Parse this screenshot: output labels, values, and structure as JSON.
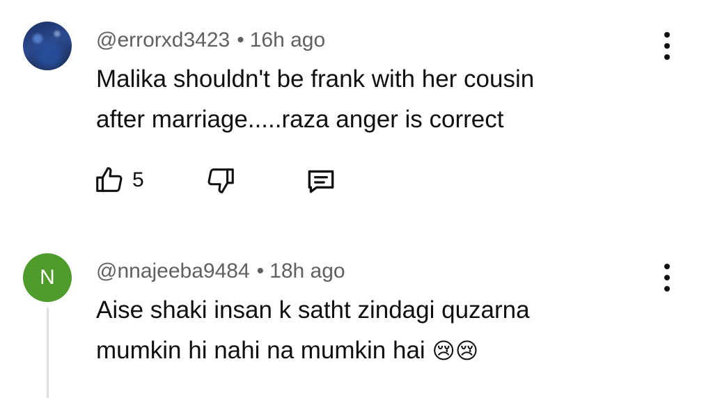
{
  "comments": [
    {
      "handle": "@errorxd3423",
      "separator": "•",
      "time": "16h ago",
      "text_line1": "Malika shouldn't be frank with her cousin",
      "text_line2": "after marriage.....raza anger is correct",
      "likes": "5",
      "avatar_type": "photo"
    },
    {
      "handle": "@nnajeeba9484",
      "separator": "•",
      "time": "18h ago",
      "text_line1": "Aise shaki insan k satht zindagi quzarna",
      "text_line2": "mumkin hi nahi na mumkin hai",
      "emoji": "😢😢",
      "avatar_letter": "N",
      "avatar_color": "#4f9b2c"
    }
  ],
  "icons": {
    "like": "thumbs-up-icon",
    "dislike": "thumbs-down-icon",
    "reply": "reply-comment-icon",
    "more": "more-vertical-icon"
  }
}
